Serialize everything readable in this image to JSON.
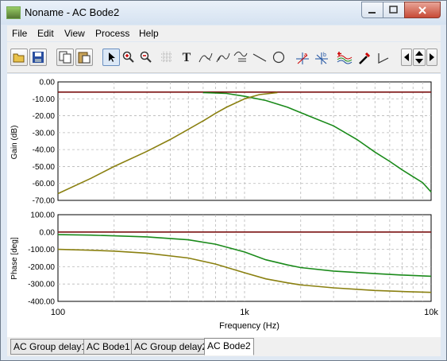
{
  "window": {
    "title": "Noname - AC Bode2",
    "min_label": "▭",
    "max_label": "▢",
    "close_label": "✕"
  },
  "menu": [
    "File",
    "Edit",
    "View",
    "Process",
    "Help"
  ],
  "toolbar": {
    "text_tool_label": "T",
    "tools": [
      "open-icon",
      "save-icon",
      "copy-icon",
      "paste-icon",
      "pointer-icon",
      "zoom-in-icon",
      "zoom-out-icon",
      "grid-icon",
      "text-icon",
      "marker-icon",
      "marker2-icon",
      "marker3-icon",
      "line-icon",
      "circle-icon",
      "cursor-a-icon",
      "cursor-b-icon",
      "curves-icon",
      "dropper-icon",
      "step-icon",
      "arrow-left-icon",
      "arrow-updown-icon",
      "arrow-right-icon"
    ]
  },
  "gain_chart": {
    "ylabel": "Gain (dB)",
    "ticks": [
      "0.00",
      "-10.00",
      "-20.00",
      "-30.00",
      "-40.00",
      "-50.00",
      "-60.00",
      "-70.00"
    ]
  },
  "phase_chart": {
    "ylabel": "Phase [deg]",
    "ticks": [
      "100.00",
      "0.00",
      "-100.00",
      "-200.00",
      "-300.00",
      "-400.00"
    ]
  },
  "x_axis": {
    "label": "Frequency (Hz)",
    "ticks": [
      "100",
      "1k",
      "10k"
    ]
  },
  "colors": {
    "series_flat": "#7a1010",
    "series_green": "#1a8a1a",
    "series_olive": "#8a8010",
    "grid": "#b8b8b8"
  },
  "chart_data": [
    {
      "type": "line",
      "x_scale": "log",
      "xlim": [
        100,
        10000
      ],
      "ylim": [
        -70,
        0
      ],
      "ylabel": "Gain (dB)",
      "xlabel": "Frequency (Hz)",
      "series": [
        {
          "color": "#7a1010",
          "x": [
            100,
            10000
          ],
          "y": [
            -6,
            -6
          ]
        },
        {
          "color": "#1a8a1a",
          "x": [
            600,
            800,
            1000,
            1300,
            1700,
            2200,
            3000,
            4000,
            5000,
            6000,
            7000,
            8000,
            9000,
            10000
          ],
          "y": [
            -6.3,
            -6.8,
            -8.5,
            -11,
            -15,
            -20,
            -26,
            -34,
            -41.5,
            -47,
            -52,
            -56,
            -59.5,
            -65
          ]
        },
        {
          "color": "#8a8010",
          "x": [
            100,
            150,
            200,
            300,
            400,
            500,
            600,
            700,
            800,
            1000,
            1200,
            1500
          ],
          "y": [
            -66,
            -57,
            -50,
            -41,
            -34,
            -28,
            -23,
            -18.5,
            -15,
            -10,
            -7.5,
            -6.3
          ]
        }
      ]
    },
    {
      "type": "line",
      "x_scale": "log",
      "xlim": [
        100,
        10000
      ],
      "ylim": [
        -400,
        100
      ],
      "ylabel": "Phase [deg]",
      "xlabel": "Frequency (Hz)",
      "series": [
        {
          "color": "#7a1010",
          "x": [
            100,
            10000
          ],
          "y": [
            0,
            0
          ]
        },
        {
          "color": "#1a8a1a",
          "x": [
            100,
            150,
            200,
            300,
            500,
            700,
            1000,
            1300,
            1700,
            2000,
            3000,
            5000,
            7000,
            10000
          ],
          "y": [
            -15,
            -18,
            -22,
            -28,
            -45,
            -70,
            -115,
            -160,
            -190,
            -205,
            -225,
            -240,
            -248,
            -255
          ]
        },
        {
          "color": "#8a8010",
          "x": [
            100,
            150,
            200,
            300,
            500,
            700,
            1000,
            1300,
            1700,
            2000,
            3000,
            5000,
            7000,
            10000
          ],
          "y": [
            -100,
            -105,
            -110,
            -122,
            -150,
            -185,
            -235,
            -270,
            -293,
            -305,
            -322,
            -337,
            -343,
            -348
          ]
        }
      ]
    }
  ],
  "tabs": [
    "AC Group delay1",
    "AC Bode1",
    "AC Group delay2",
    "AC Bode2"
  ]
}
